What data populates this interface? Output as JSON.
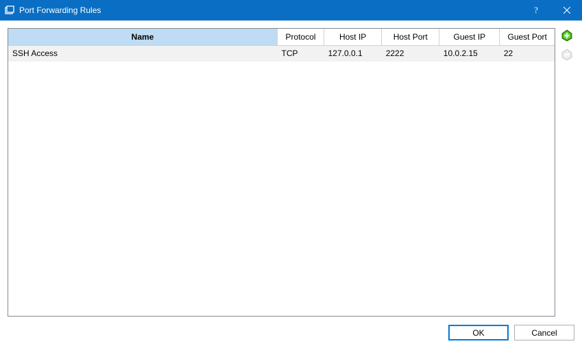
{
  "window": {
    "title": "Port Forwarding Rules"
  },
  "table": {
    "columns": {
      "name": "Name",
      "protocol": "Protocol",
      "host_ip": "Host IP",
      "host_port": "Host Port",
      "guest_ip": "Guest IP",
      "guest_port": "Guest Port"
    },
    "rows": [
      {
        "name": "SSH Access",
        "protocol": "TCP",
        "host_ip": "127.0.0.1",
        "host_port": "2222",
        "guest_ip": "10.0.2.15",
        "guest_port": "22"
      }
    ]
  },
  "sidebar": {
    "add_icon": "add-rule-icon",
    "remove_icon": "remove-rule-icon"
  },
  "footer": {
    "ok": "OK",
    "cancel": "Cancel"
  }
}
